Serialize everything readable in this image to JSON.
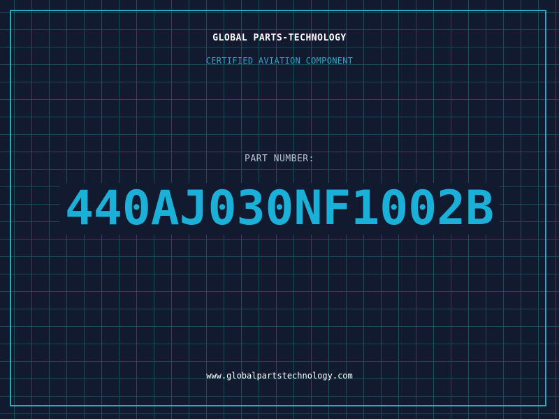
{
  "header": {
    "company": "GLOBAL PARTS-TECHNOLOGY",
    "tagline": "CERTIFIED AVIATION COMPONENT"
  },
  "part": {
    "label": "PART NUMBER:",
    "number": "440AJ030NF1002B"
  },
  "footer": {
    "url": "www.globalpartstechnology.com"
  },
  "colors": {
    "background": "#121a30",
    "grid": "#1e4b5c",
    "accent": "#29a8c8",
    "part_number": "#1ab0d8",
    "label": "#b8c2d2",
    "text": "#ffffff"
  }
}
